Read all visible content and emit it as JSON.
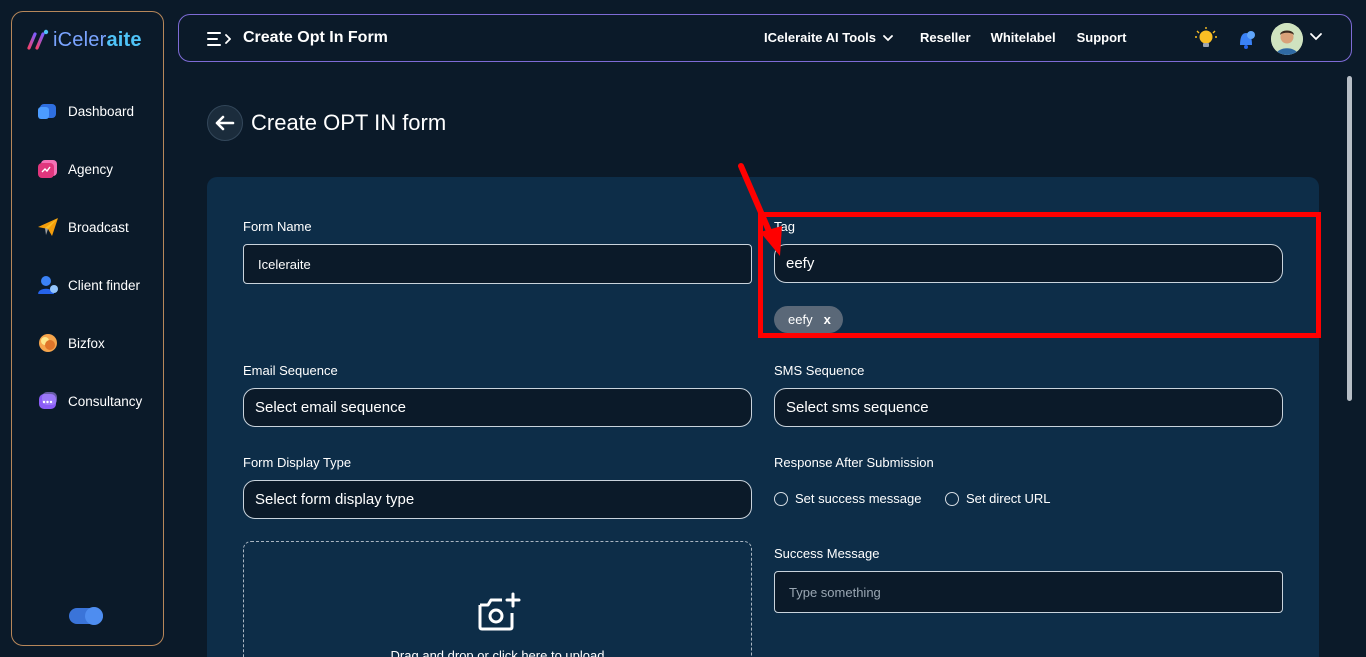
{
  "brand": {
    "name_part1": "iCeler",
    "name_part2": "aite"
  },
  "sidebar": {
    "items": [
      {
        "label": "Dashboard",
        "icon": "dashboard-icon",
        "color": "#3b82f6"
      },
      {
        "label": "Agency",
        "icon": "agency-icon",
        "color": "#ec4899"
      },
      {
        "label": "Broadcast",
        "icon": "broadcast-icon",
        "color": "#f59e0b"
      },
      {
        "label": "Client finder",
        "icon": "client-finder-icon",
        "color": "#3b82f6"
      },
      {
        "label": "Bizfox",
        "icon": "bizfox-icon",
        "color": "#f97316"
      },
      {
        "label": "Consultancy",
        "icon": "consultancy-icon",
        "color": "#8b5cf6"
      }
    ],
    "theme_toggle_on": true
  },
  "topbar": {
    "title": "Create Opt In Form",
    "links": [
      {
        "label": "ICeleraite AI Tools",
        "has_dropdown": true
      },
      {
        "label": "Reseller",
        "has_dropdown": false
      },
      {
        "label": "Whitelabel",
        "has_dropdown": false
      },
      {
        "label": "Support",
        "has_dropdown": false
      }
    ]
  },
  "page": {
    "title": "Create OPT IN form"
  },
  "form": {
    "form_name": {
      "label": "Form Name",
      "value": "Iceleraite"
    },
    "tag": {
      "label": "Tag",
      "value": "eefy",
      "chips": [
        "eefy"
      ],
      "chip_remove": "x"
    },
    "email_sequence": {
      "label": "Email Sequence",
      "placeholder": "Select email sequence"
    },
    "sms_sequence": {
      "label": "SMS Sequence",
      "placeholder": "Select sms sequence"
    },
    "display_type": {
      "label": "Form Display Type",
      "placeholder": "Select form display type"
    },
    "response": {
      "label": "Response After Submission",
      "options": [
        "Set success message",
        "Set direct URL"
      ]
    },
    "success_message": {
      "label": "Success Message",
      "placeholder": "Type something"
    },
    "upload": {
      "text": "Drag and drop or click here to upload"
    }
  },
  "colors": {
    "accent_highlight": "#ff0000",
    "card_bg": "#0d2d48",
    "page_bg": "#0b1a29"
  }
}
